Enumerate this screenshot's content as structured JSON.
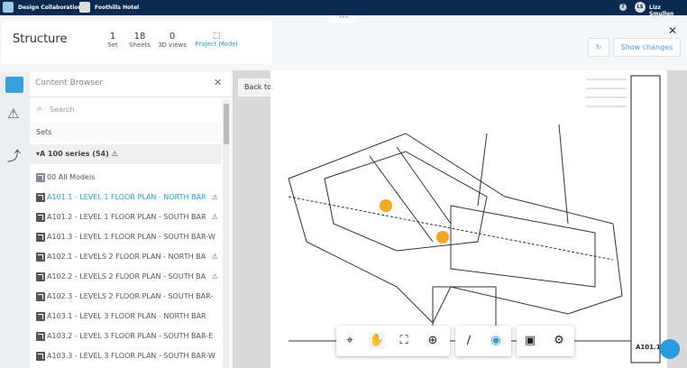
{
  "topbar": {
    "app": "Design Collaboration",
    "project": "Foothills Hotel",
    "help": "?",
    "avatar": "LS",
    "user": "Lizz Smullen"
  },
  "header": {
    "title": "Structure",
    "stats": [
      {
        "value": "1",
        "label": "Set"
      },
      {
        "value": "18",
        "label": "Sheets"
      },
      {
        "value": "0",
        "label": "3D views"
      }
    ],
    "project_model": "Project Model",
    "show_changes": "Show changes",
    "close": "✕",
    "more": "•••"
  },
  "content_browser": {
    "title": "Content Browser",
    "close": "✕",
    "search_placeholder": "Search",
    "sets": "Sets",
    "group": "A 100 series (54)",
    "all_models": "00 All Models",
    "items": [
      {
        "label": "A101.1 - LEVEL 1 FLOOR PLAN - NORTH BAR",
        "warn": true,
        "active": true
      },
      {
        "label": "A101.2 - LEVEL 1 FLOOR PLAN - SOUTH BAR",
        "warn": true
      },
      {
        "label": "A101.3 - LEVEL 1 FLOOR PLAN - SOUTH BAR-W",
        "warn": false
      },
      {
        "label": "A102.1 - LEVELS 2 FLOOR PLAN - NORTH BA",
        "warn": true
      },
      {
        "label": "A102.2 - LEVELS 2 FLOOR PLAN - SOUTH BA",
        "warn": true
      },
      {
        "label": "A102.3 - LEVELS 2 FLOOR PLAN - SOUTH BAR-",
        "warn": false
      },
      {
        "label": "A103.1 - LEVEL 3 FLOOR PLAN - NORTH BAR",
        "warn": false
      },
      {
        "label": "A103.2 - LEVEL 3 FLOOR PLAN - SOUTH BAR-E",
        "warn": false
      },
      {
        "label": "A103.3 - LEVEL 3 FLOOR PLAN - SOUTH BAR-W",
        "warn": false
      }
    ]
  },
  "viewer": {
    "back_label": "Back to last view",
    "sheet_number": "A101.1"
  },
  "colors": {
    "navy": "#0b2a52",
    "accent": "#2a9be0",
    "marker": "#f5a623"
  }
}
